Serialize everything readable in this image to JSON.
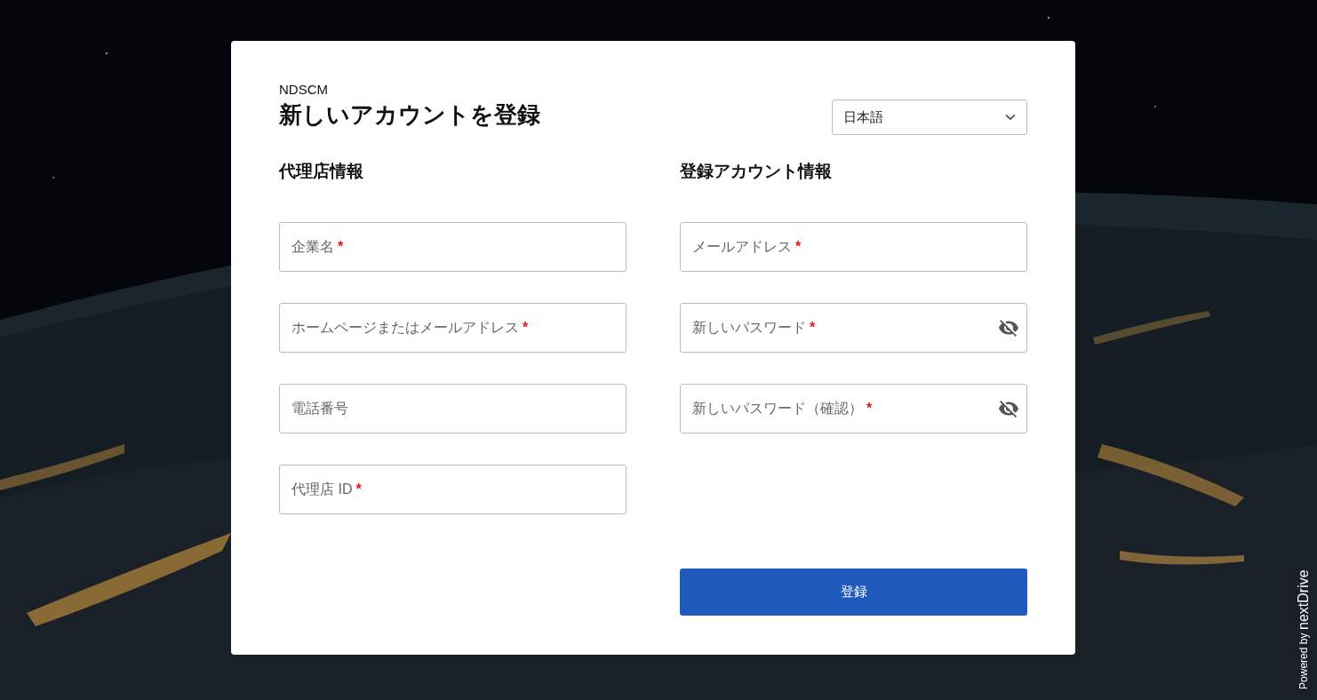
{
  "app_name": "NDSCM",
  "title": "新しいアカウントを登録",
  "language_select": {
    "value": "日本語"
  },
  "sections": [
    {
      "heading": "代理店情報",
      "fields": [
        {
          "kind": "text",
          "label": "企業名",
          "mark": "*"
        },
        {
          "kind": "text",
          "label": "ホームページまたはメールアドレス",
          "mark": "*"
        },
        {
          "kind": "text",
          "label": "電話番号"
        },
        {
          "kind": "text",
          "label": "代理店 ID",
          "mark": "*"
        }
      ]
    },
    {
      "heading": "登録アカウント情報",
      "fields": [
        {
          "kind": "text",
          "label": "メールアドレス",
          "mark": "*"
        },
        {
          "kind": "password",
          "label": "新しいパスワード",
          "mark": "*"
        },
        {
          "kind": "password",
          "label": "新しいパスワード（確認）",
          "mark": "*"
        }
      ]
    }
  ],
  "submit_button": "登録",
  "footer": {
    "powered_by": "Powered by",
    "brand": "nextDrive"
  }
}
